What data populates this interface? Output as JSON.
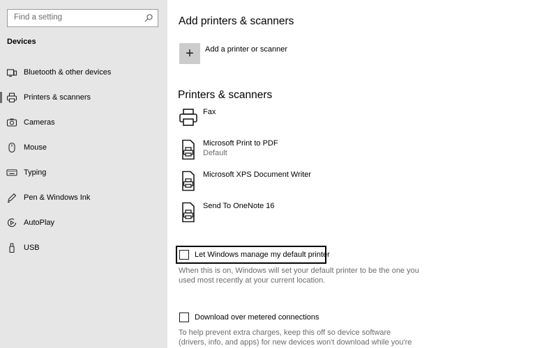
{
  "search": {
    "placeholder": "Find a setting"
  },
  "sidebar": {
    "section_title": "Devices",
    "items": [
      {
        "label": "Bluetooth & other devices",
        "icon": "bluetooth-devices-icon"
      },
      {
        "label": "Printers & scanners",
        "icon": "printer-icon",
        "selected": true
      },
      {
        "label": "Cameras",
        "icon": "camera-icon"
      },
      {
        "label": "Mouse",
        "icon": "mouse-icon"
      },
      {
        "label": "Typing",
        "icon": "keyboard-icon"
      },
      {
        "label": "Pen & Windows Ink",
        "icon": "pen-icon"
      },
      {
        "label": "AutoPlay",
        "icon": "autoplay-icon"
      },
      {
        "label": "USB",
        "icon": "usb-icon"
      }
    ]
  },
  "main": {
    "add_heading": "Add printers & scanners",
    "add_button_label": "Add a printer or scanner",
    "list_heading": "Printers & scanners",
    "printers": [
      {
        "name": "Fax",
        "sub": "",
        "icon": "fax-printer-icon"
      },
      {
        "name": "Microsoft Print to PDF",
        "sub": "Default",
        "icon": "document-printer-icon"
      },
      {
        "name": "Microsoft XPS Document Writer",
        "sub": "",
        "icon": "document-printer-icon"
      },
      {
        "name": "Send To OneNote 16",
        "sub": "",
        "icon": "document-printer-icon"
      }
    ],
    "let_windows_manage": {
      "label": "Let Windows manage my default printer",
      "checked": false,
      "description": "When this is on, Windows will set your default printer to be the one you used most recently at your current location."
    },
    "metered": {
      "label": "Download over metered connections",
      "checked": false,
      "description": "To help prevent extra charges, keep this off so device software (drivers, info, and apps) for new devices won't download while you're on"
    }
  }
}
